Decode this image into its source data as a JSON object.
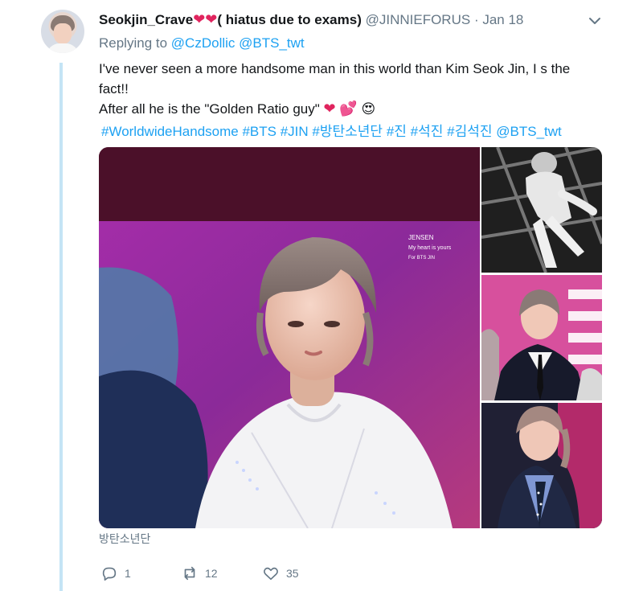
{
  "tweet": {
    "display_name": "Seokjin_Crave",
    "name_suffix": "( hiatus due to exams)",
    "handle": "@JINNIEFORUS",
    "separator": "·",
    "timestamp": "Jan 18",
    "replying_to_label": "Replying to",
    "replying_to": [
      "@CzDollic",
      "@BTS_twt"
    ],
    "text_line1": "I've never seen a more handsome man in this world than Kim Seok Jin, I s the fact!!",
    "text_line2": "After all he is the \"Golden Ratio guy\"",
    "hashtags": [
      "#WorldwideHandsome",
      "#BTS",
      "#JIN",
      "#방탄소년단",
      "#진",
      "#석진",
      "#김석진",
      "@BTS_twt"
    ],
    "photo_watermark": "JENSEN\nMy heart is yours\nFor BTS JIN",
    "location": "방탄소년단",
    "actions": {
      "reply_count": "1",
      "retweet_count": "12",
      "like_count": "35"
    }
  },
  "icons": {
    "avatar": "avatar",
    "chevron": "chevron-down-icon",
    "reply": "reply-icon",
    "retweet": "retweet-icon",
    "like": "heart-icon"
  },
  "colors": {
    "link": "#1da1f2",
    "secondary_text": "#657786",
    "heart": "#e0245e",
    "thread_line": "#c4e4f5"
  }
}
